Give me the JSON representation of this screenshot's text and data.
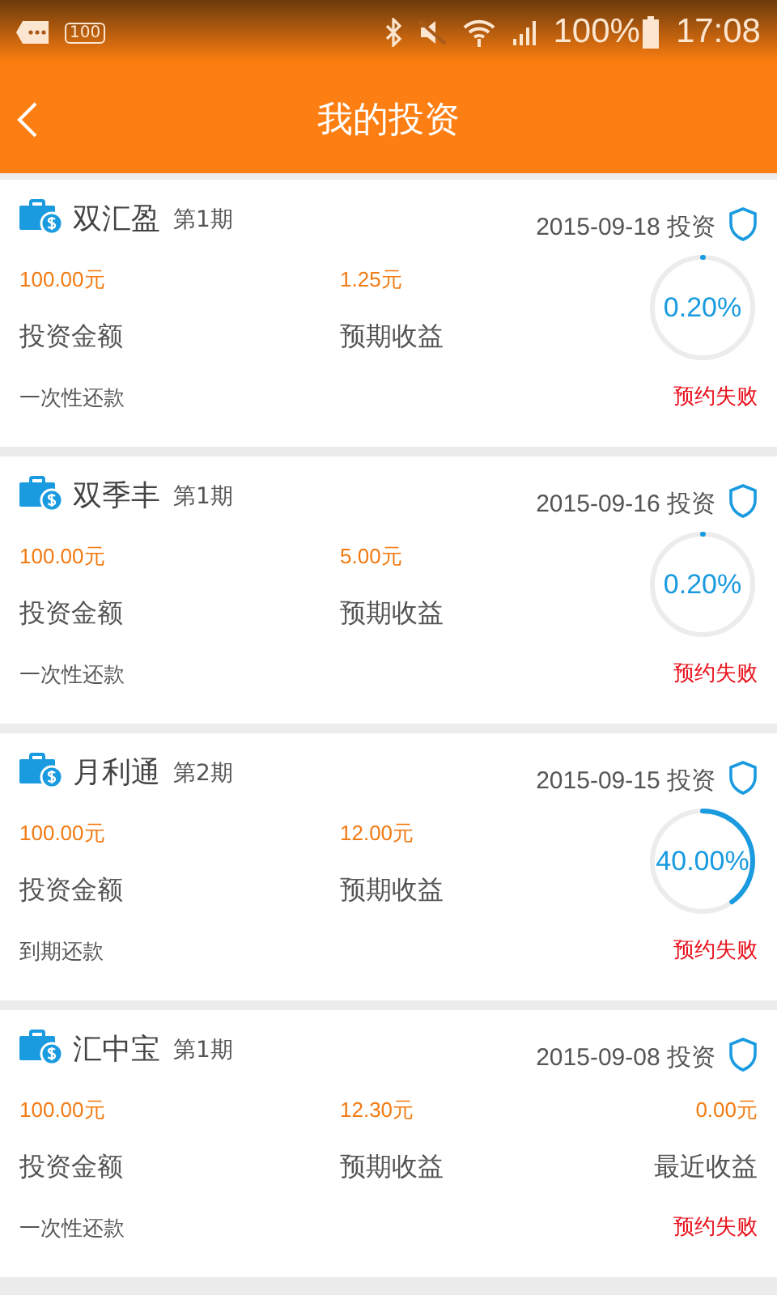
{
  "status_bar": {
    "badge": "100",
    "battery": "100%",
    "time": "17:08"
  },
  "header": {
    "title": "我的投资"
  },
  "investments": [
    {
      "kind": "progress",
      "name": "双汇盈",
      "period": "第1期",
      "date": "2015-09-18 投资",
      "amount": "100.00元",
      "amount_label": "投资金额",
      "expected": "1.25元",
      "expected_label": "预期收益",
      "repayment": "一次性还款",
      "progress": "0.20%",
      "level": 0.002,
      "status": "预约失败"
    },
    {
      "kind": "progress",
      "name": "双季丰",
      "period": "第1期",
      "date": "2015-09-16 投资",
      "amount": "100.00元",
      "amount_label": "投资金额",
      "expected": "5.00元",
      "expected_label": "预期收益",
      "repayment": "一次性还款",
      "progress": "0.20%",
      "level": 0.002,
      "status": "预约失败"
    },
    {
      "kind": "progress",
      "name": "月利通",
      "period": "第2期",
      "date": "2015-09-15 投资",
      "amount": "100.00元",
      "amount_label": "投资金额",
      "expected": "12.00元",
      "expected_label": "预期收益",
      "repayment": "到期还款",
      "progress": "40.00%",
      "level": 0.4,
      "status": "预约失败"
    },
    {
      "kind": "earnings",
      "name": "汇中宝",
      "period": "第1期",
      "date": "2015-09-08 投资",
      "amount": "100.00元",
      "amount_label": "投资金额",
      "expected": "12.30元",
      "expected_label": "预期收益",
      "recent": "0.00元",
      "recent_label": "最近收益",
      "repayment": "一次性还款",
      "status": "预约失败"
    }
  ]
}
